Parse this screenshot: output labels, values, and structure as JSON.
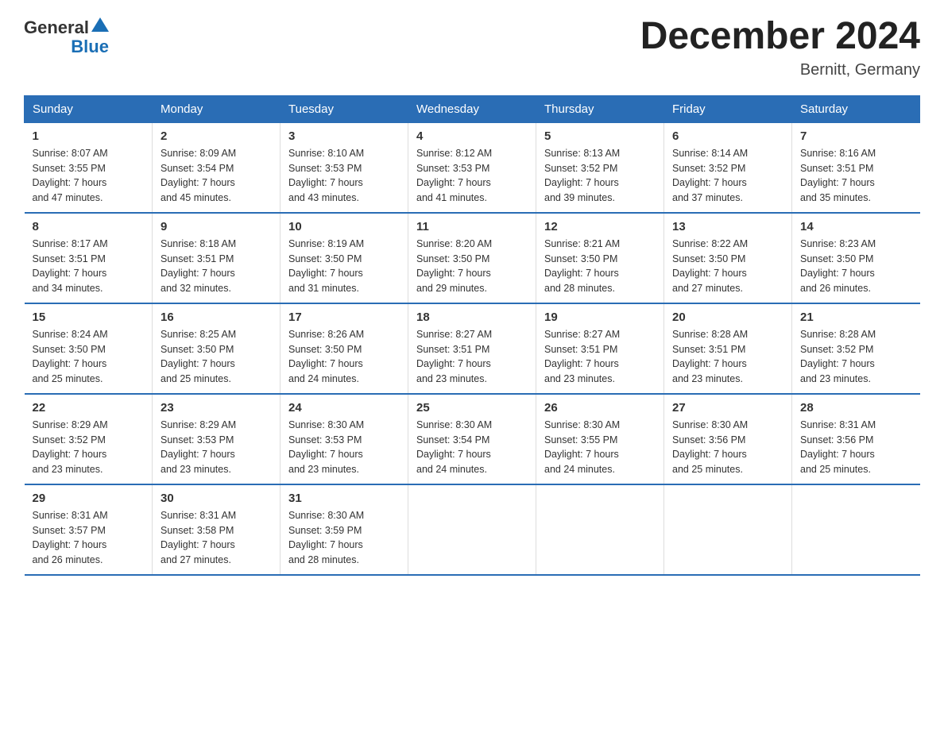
{
  "header": {
    "logo_general": "General",
    "logo_blue": "Blue",
    "month_title": "December 2024",
    "location": "Bernitt, Germany"
  },
  "days_of_week": [
    "Sunday",
    "Monday",
    "Tuesday",
    "Wednesday",
    "Thursday",
    "Friday",
    "Saturday"
  ],
  "weeks": [
    [
      {
        "day": "1",
        "sunrise": "Sunrise: 8:07 AM",
        "sunset": "Sunset: 3:55 PM",
        "daylight": "Daylight: 7 hours",
        "minutes": "and 47 minutes."
      },
      {
        "day": "2",
        "sunrise": "Sunrise: 8:09 AM",
        "sunset": "Sunset: 3:54 PM",
        "daylight": "Daylight: 7 hours",
        "minutes": "and 45 minutes."
      },
      {
        "day": "3",
        "sunrise": "Sunrise: 8:10 AM",
        "sunset": "Sunset: 3:53 PM",
        "daylight": "Daylight: 7 hours",
        "minutes": "and 43 minutes."
      },
      {
        "day": "4",
        "sunrise": "Sunrise: 8:12 AM",
        "sunset": "Sunset: 3:53 PM",
        "daylight": "Daylight: 7 hours",
        "minutes": "and 41 minutes."
      },
      {
        "day": "5",
        "sunrise": "Sunrise: 8:13 AM",
        "sunset": "Sunset: 3:52 PM",
        "daylight": "Daylight: 7 hours",
        "minutes": "and 39 minutes."
      },
      {
        "day": "6",
        "sunrise": "Sunrise: 8:14 AM",
        "sunset": "Sunset: 3:52 PM",
        "daylight": "Daylight: 7 hours",
        "minutes": "and 37 minutes."
      },
      {
        "day": "7",
        "sunrise": "Sunrise: 8:16 AM",
        "sunset": "Sunset: 3:51 PM",
        "daylight": "Daylight: 7 hours",
        "minutes": "and 35 minutes."
      }
    ],
    [
      {
        "day": "8",
        "sunrise": "Sunrise: 8:17 AM",
        "sunset": "Sunset: 3:51 PM",
        "daylight": "Daylight: 7 hours",
        "minutes": "and 34 minutes."
      },
      {
        "day": "9",
        "sunrise": "Sunrise: 8:18 AM",
        "sunset": "Sunset: 3:51 PM",
        "daylight": "Daylight: 7 hours",
        "minutes": "and 32 minutes."
      },
      {
        "day": "10",
        "sunrise": "Sunrise: 8:19 AM",
        "sunset": "Sunset: 3:50 PM",
        "daylight": "Daylight: 7 hours",
        "minutes": "and 31 minutes."
      },
      {
        "day": "11",
        "sunrise": "Sunrise: 8:20 AM",
        "sunset": "Sunset: 3:50 PM",
        "daylight": "Daylight: 7 hours",
        "minutes": "and 29 minutes."
      },
      {
        "day": "12",
        "sunrise": "Sunrise: 8:21 AM",
        "sunset": "Sunset: 3:50 PM",
        "daylight": "Daylight: 7 hours",
        "minutes": "and 28 minutes."
      },
      {
        "day": "13",
        "sunrise": "Sunrise: 8:22 AM",
        "sunset": "Sunset: 3:50 PM",
        "daylight": "Daylight: 7 hours",
        "minutes": "and 27 minutes."
      },
      {
        "day": "14",
        "sunrise": "Sunrise: 8:23 AM",
        "sunset": "Sunset: 3:50 PM",
        "daylight": "Daylight: 7 hours",
        "minutes": "and 26 minutes."
      }
    ],
    [
      {
        "day": "15",
        "sunrise": "Sunrise: 8:24 AM",
        "sunset": "Sunset: 3:50 PM",
        "daylight": "Daylight: 7 hours",
        "minutes": "and 25 minutes."
      },
      {
        "day": "16",
        "sunrise": "Sunrise: 8:25 AM",
        "sunset": "Sunset: 3:50 PM",
        "daylight": "Daylight: 7 hours",
        "minutes": "and 25 minutes."
      },
      {
        "day": "17",
        "sunrise": "Sunrise: 8:26 AM",
        "sunset": "Sunset: 3:50 PM",
        "daylight": "Daylight: 7 hours",
        "minutes": "and 24 minutes."
      },
      {
        "day": "18",
        "sunrise": "Sunrise: 8:27 AM",
        "sunset": "Sunset: 3:51 PM",
        "daylight": "Daylight: 7 hours",
        "minutes": "and 23 minutes."
      },
      {
        "day": "19",
        "sunrise": "Sunrise: 8:27 AM",
        "sunset": "Sunset: 3:51 PM",
        "daylight": "Daylight: 7 hours",
        "minutes": "and 23 minutes."
      },
      {
        "day": "20",
        "sunrise": "Sunrise: 8:28 AM",
        "sunset": "Sunset: 3:51 PM",
        "daylight": "Daylight: 7 hours",
        "minutes": "and 23 minutes."
      },
      {
        "day": "21",
        "sunrise": "Sunrise: 8:28 AM",
        "sunset": "Sunset: 3:52 PM",
        "daylight": "Daylight: 7 hours",
        "minutes": "and 23 minutes."
      }
    ],
    [
      {
        "day": "22",
        "sunrise": "Sunrise: 8:29 AM",
        "sunset": "Sunset: 3:52 PM",
        "daylight": "Daylight: 7 hours",
        "minutes": "and 23 minutes."
      },
      {
        "day": "23",
        "sunrise": "Sunrise: 8:29 AM",
        "sunset": "Sunset: 3:53 PM",
        "daylight": "Daylight: 7 hours",
        "minutes": "and 23 minutes."
      },
      {
        "day": "24",
        "sunrise": "Sunrise: 8:30 AM",
        "sunset": "Sunset: 3:53 PM",
        "daylight": "Daylight: 7 hours",
        "minutes": "and 23 minutes."
      },
      {
        "day": "25",
        "sunrise": "Sunrise: 8:30 AM",
        "sunset": "Sunset: 3:54 PM",
        "daylight": "Daylight: 7 hours",
        "minutes": "and 24 minutes."
      },
      {
        "day": "26",
        "sunrise": "Sunrise: 8:30 AM",
        "sunset": "Sunset: 3:55 PM",
        "daylight": "Daylight: 7 hours",
        "minutes": "and 24 minutes."
      },
      {
        "day": "27",
        "sunrise": "Sunrise: 8:30 AM",
        "sunset": "Sunset: 3:56 PM",
        "daylight": "Daylight: 7 hours",
        "minutes": "and 25 minutes."
      },
      {
        "day": "28",
        "sunrise": "Sunrise: 8:31 AM",
        "sunset": "Sunset: 3:56 PM",
        "daylight": "Daylight: 7 hours",
        "minutes": "and 25 minutes."
      }
    ],
    [
      {
        "day": "29",
        "sunrise": "Sunrise: 8:31 AM",
        "sunset": "Sunset: 3:57 PM",
        "daylight": "Daylight: 7 hours",
        "minutes": "and 26 minutes."
      },
      {
        "day": "30",
        "sunrise": "Sunrise: 8:31 AM",
        "sunset": "Sunset: 3:58 PM",
        "daylight": "Daylight: 7 hours",
        "minutes": "and 27 minutes."
      },
      {
        "day": "31",
        "sunrise": "Sunrise: 8:30 AM",
        "sunset": "Sunset: 3:59 PM",
        "daylight": "Daylight: 7 hours",
        "minutes": "and 28 minutes."
      },
      {
        "day": "",
        "sunrise": "",
        "sunset": "",
        "daylight": "",
        "minutes": ""
      },
      {
        "day": "",
        "sunrise": "",
        "sunset": "",
        "daylight": "",
        "minutes": ""
      },
      {
        "day": "",
        "sunrise": "",
        "sunset": "",
        "daylight": "",
        "minutes": ""
      },
      {
        "day": "",
        "sunrise": "",
        "sunset": "",
        "daylight": "",
        "minutes": ""
      }
    ]
  ]
}
